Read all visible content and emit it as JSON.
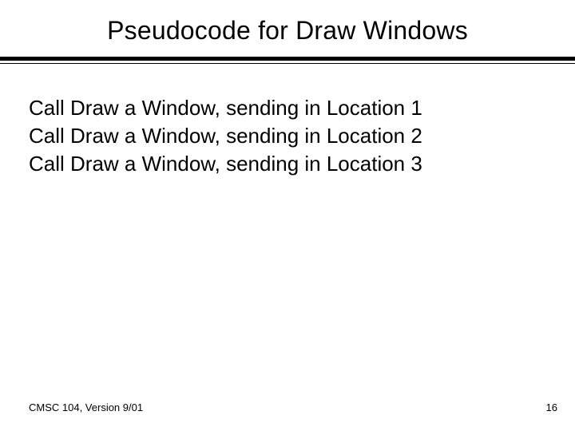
{
  "title": "Pseudocode for Draw Windows",
  "lines": [
    "Call Draw a Window, sending in Location 1",
    "Call Draw a Window, sending in Location 2",
    "Call Draw a Window, sending in Location 3"
  ],
  "footer": {
    "left": "CMSC 104, Version 9/01",
    "right": "16"
  }
}
